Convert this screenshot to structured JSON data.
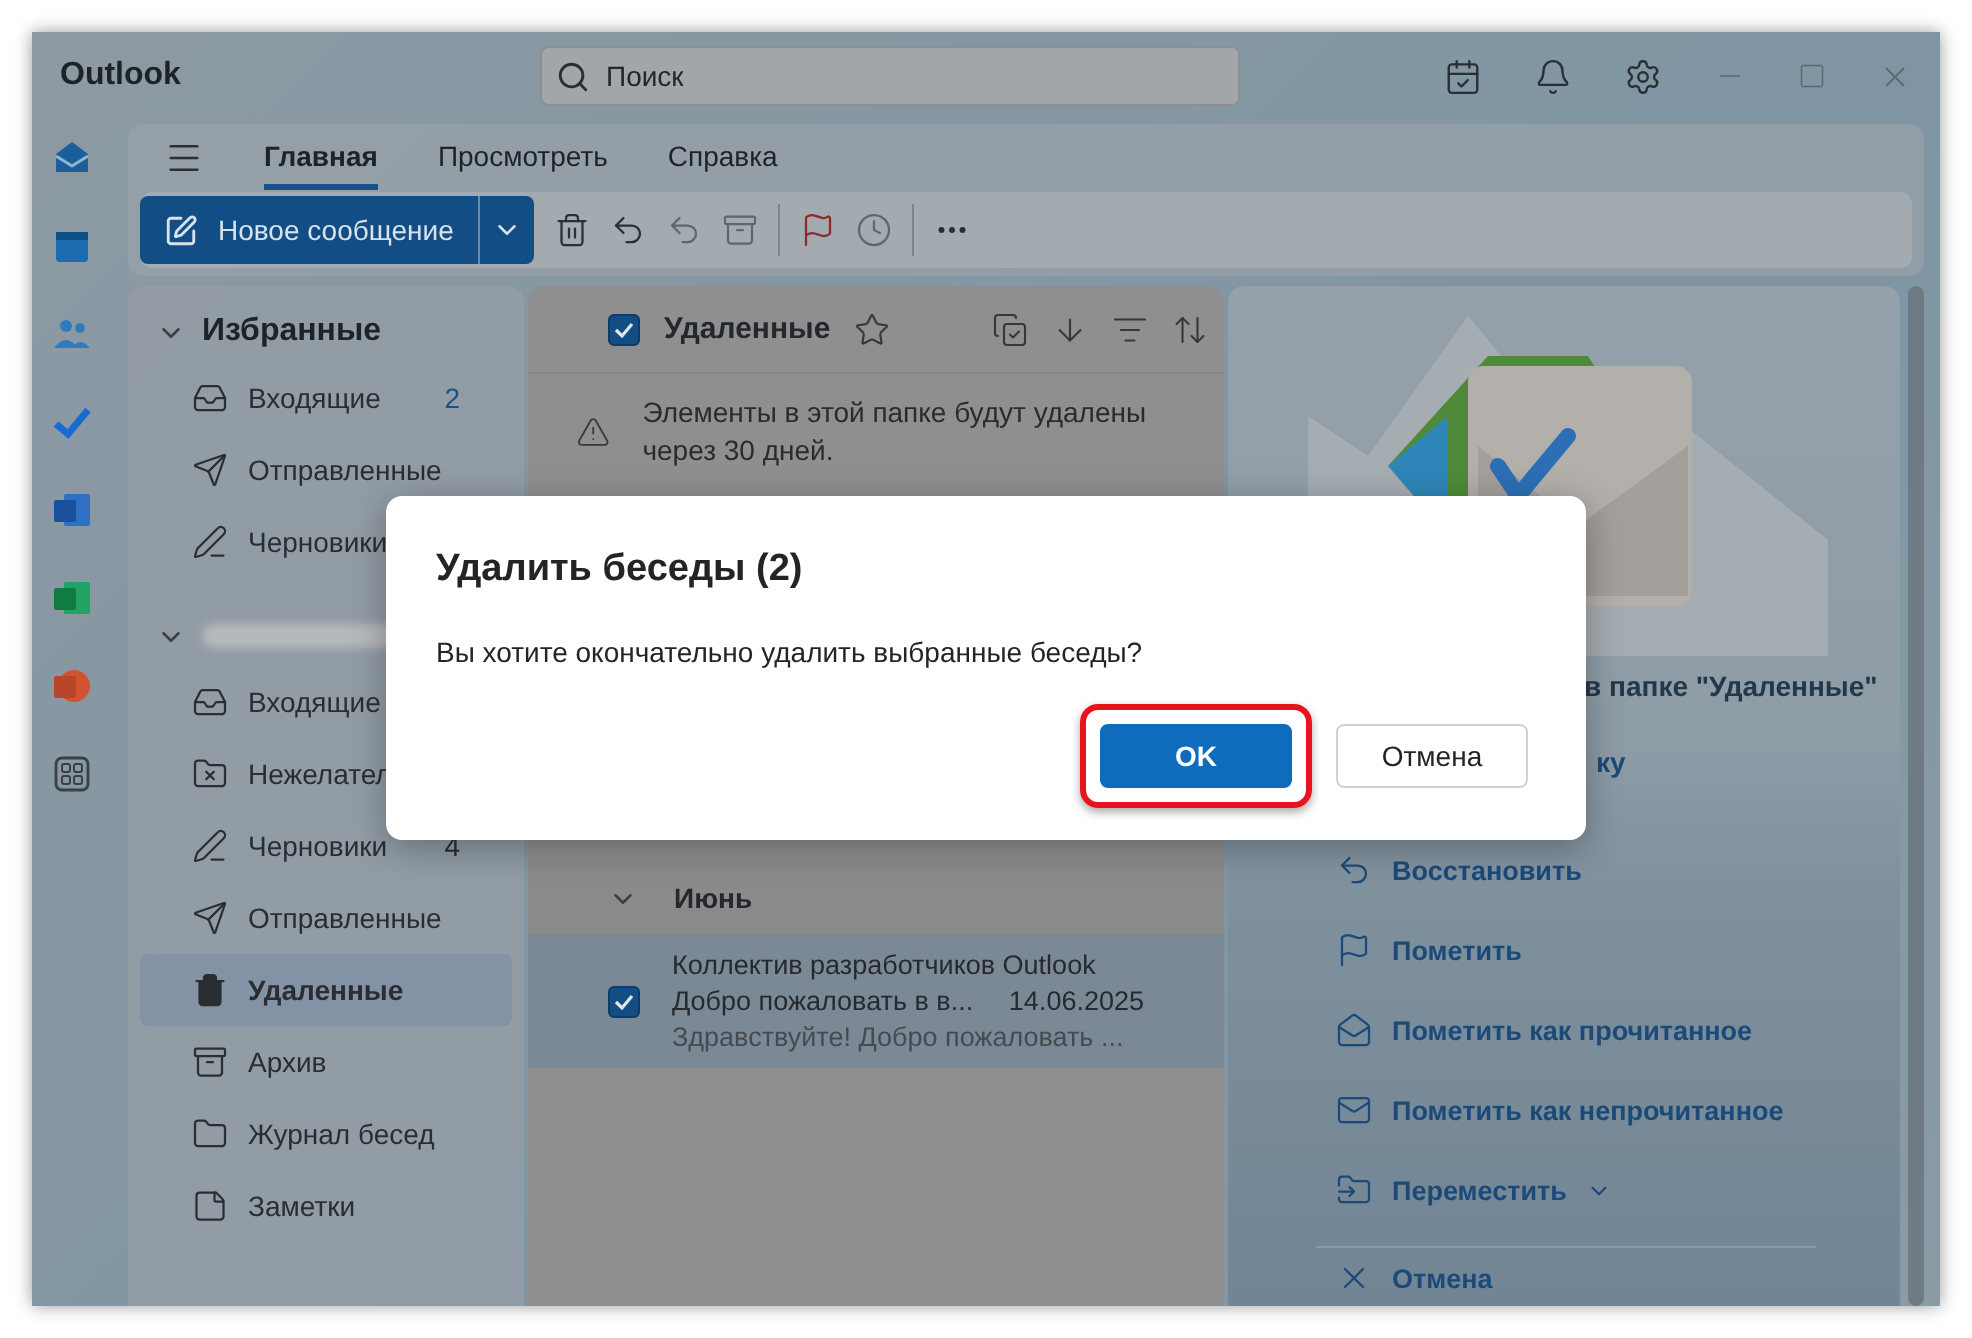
{
  "window": {
    "title": "Outlook"
  },
  "search": {
    "placeholder": "Поиск"
  },
  "ribbon": {
    "tabs": [
      {
        "label": "Главная",
        "selected": true
      },
      {
        "label": "Просмотреть",
        "selected": false
      },
      {
        "label": "Справка",
        "selected": false
      }
    ],
    "new_message": "Новое сообщение"
  },
  "favorites": {
    "title": "Избранные",
    "expanded": true,
    "items": [
      {
        "kind": "inbox",
        "label": "Входящие",
        "count": "2",
        "selected": false
      },
      {
        "kind": "sent",
        "label": "Отправленные",
        "selected": false
      },
      {
        "kind": "drafts",
        "label": "Черновики",
        "selected": false
      }
    ]
  },
  "account": {
    "expanded": true,
    "items": [
      {
        "kind": "inbox",
        "label": "Входящие",
        "selected": false
      },
      {
        "kind": "junk",
        "label": "Нежелател",
        "selected": false
      },
      {
        "kind": "drafts",
        "label": "Черновики",
        "count": "4",
        "selected": false
      },
      {
        "kind": "sent",
        "label": "Отправленные",
        "selected": false
      },
      {
        "kind": "deleted",
        "label": "Удаленные",
        "selected": true
      },
      {
        "kind": "archive",
        "label": "Архив",
        "selected": false
      },
      {
        "kind": "folder",
        "label": "Журнал бесед",
        "selected": false
      },
      {
        "kind": "notes",
        "label": "Заметки",
        "selected": false
      }
    ]
  },
  "message_list": {
    "folder": "Удаленные",
    "select_all_checked": true,
    "notice": "Элементы в этой папке будут удалены через 30 дней.",
    "groups": [
      {
        "label": "Июнь",
        "expanded": true,
        "messages": [
          {
            "sender": "Коллектив разработчиков Outlook",
            "subject": "Добро пожаловать в в...",
            "date": "14.06.2025",
            "preview": "Здравствуйте! Добро пожаловать ...",
            "checked": true,
            "selected": true
          }
        ]
      }
    ]
  },
  "reading_pane": {
    "heading_part": "в папке \"Удаленные\"",
    "action_part": "ку",
    "actions": [
      {
        "kind": "restore",
        "label": "Восстановить"
      },
      {
        "kind": "flag",
        "label": "Пометить"
      },
      {
        "kind": "read",
        "label": "Пометить как прочитанное"
      },
      {
        "kind": "unread",
        "label": "Пометить как непрочитанное"
      },
      {
        "kind": "move",
        "label": "Переместить",
        "menu": true
      }
    ],
    "bottom_action": {
      "kind": "cancel",
      "label": "Отмена"
    }
  },
  "dialog": {
    "title": "Удалить беседы (2)",
    "message": "Вы хотите окончательно удалить выбранные беседы?",
    "buttons": [
      {
        "label": "OK",
        "primary": true,
        "highlighted": true
      },
      {
        "label": "Отмена",
        "primary": false,
        "highlighted": false
      }
    ]
  }
}
